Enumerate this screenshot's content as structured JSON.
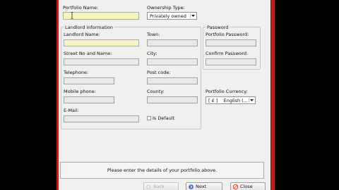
{
  "portfolio": {
    "name_label": "Portfolio Name:",
    "name_value": "",
    "ownership_label": "Ownership Type:",
    "ownership_value": "Privately owned"
  },
  "landlord": {
    "title": "Landlord information",
    "name_label": "Landlord Name:",
    "town_label": "Town:",
    "street_label": "Street No and Name:",
    "city_label": "City:",
    "telephone_label": "Telephone:",
    "postcode_label": "Post code:",
    "mobile_label": "Mobile phone:",
    "county_label": "County:",
    "email_label": "E-Mail:",
    "is_default_label": "Is Default"
  },
  "password": {
    "title": "Password",
    "portfolio_password_label": "Portfolio Password:",
    "confirm_password_label": "Confirm Password:"
  },
  "currency": {
    "label": "Portfolio Currency:",
    "value": "[ £ ]    English (..."
  },
  "status": {
    "message": "Please enter the details of your portfolio above."
  },
  "buttons": {
    "back": "Back",
    "next": "Next",
    "close": "Close"
  },
  "colors": {
    "frame_red": "#b62020",
    "highlight_field": "#f6f5c2",
    "close_icon": "#d23a2a",
    "next_icon": "#2f64c8"
  }
}
